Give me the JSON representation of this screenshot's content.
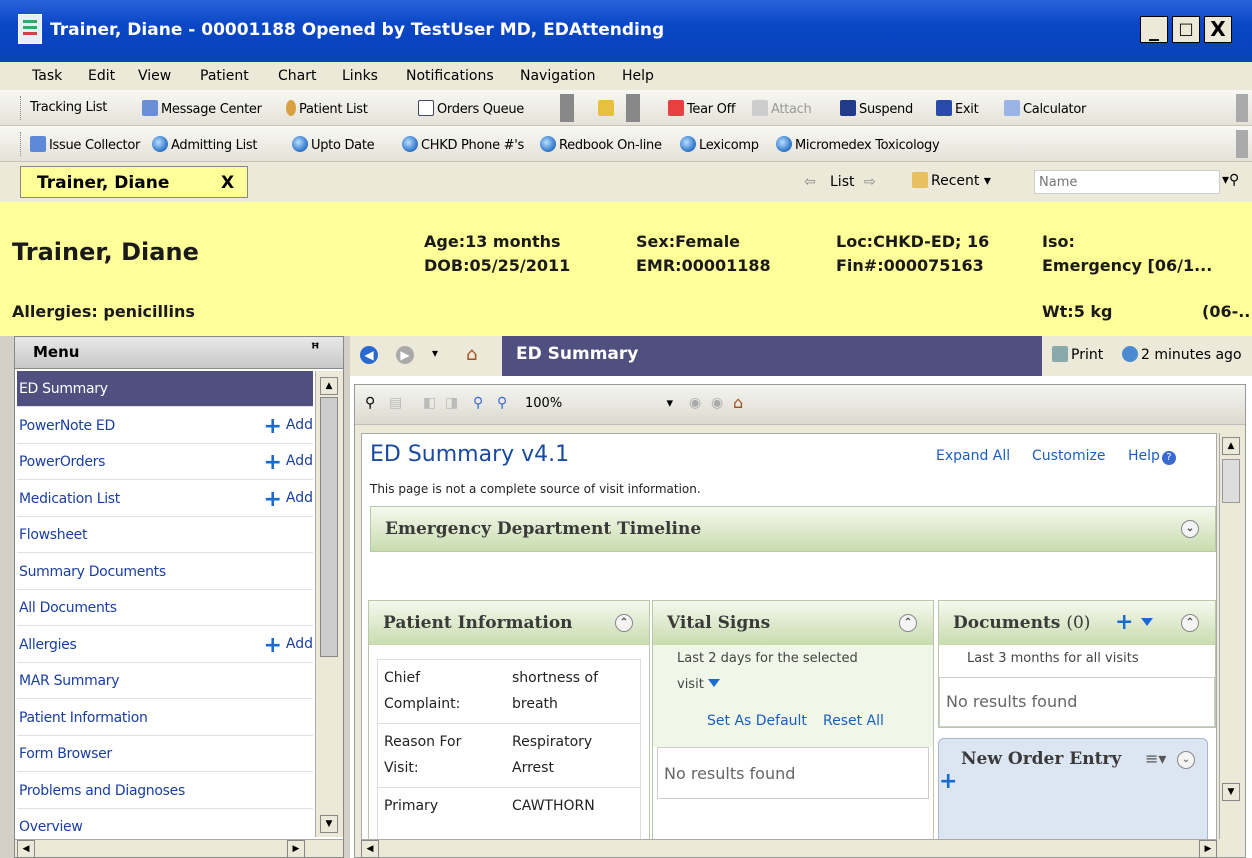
{
  "window": {
    "title": "Trainer, Diane - 00001188 Opened by TestUser MD, EDAttending",
    "minimize": "_",
    "maximize": "□",
    "close": "X"
  },
  "menubar": [
    "Task",
    "Edit",
    "View",
    "Patient",
    "Chart",
    "Links",
    "Notifications",
    "Navigation",
    "Help"
  ],
  "toolbar1": {
    "items": [
      "Tracking List",
      "Message Center",
      "Patient List",
      "Orders Queue",
      "Tear Off",
      "Attach",
      "Suspend",
      "Exit",
      "Calculator"
    ]
  },
  "toolbar2": {
    "items": [
      "Issue Collector",
      "Admitting List",
      "Upto Date",
      "CHKD Phone #'s",
      "Redbook On-line",
      "Lexicomp",
      "Micromedex Toxicology"
    ]
  },
  "tabrow": {
    "patient_tab": "Trainer, Diane",
    "tab_close": "X",
    "list_label": "List",
    "recent_label": "Recent",
    "name_placeholder": "Name"
  },
  "banner": {
    "name": "Trainer, Diane",
    "allergies": "Allergies: penicillins",
    "age": "Age:13 months",
    "dob": "DOB:05/25/2011",
    "sex": "Sex:Female",
    "emr": "EMR:00001188",
    "loc": "Loc:CHKD-ED; 16",
    "fin": "Fin#:000075163",
    "iso": "Iso:",
    "encounter": "Emergency [06/1...",
    "wt": "Wt:5 kg",
    "wt_date": "(06-..."
  },
  "leftmenu": {
    "header": "Menu",
    "pin": "ᵖ",
    "add_label": "Add",
    "items": [
      {
        "label": "ED Summary",
        "add": false,
        "selected": true
      },
      {
        "label": "PowerNote ED",
        "add": true
      },
      {
        "label": "PowerOrders",
        "add": true
      },
      {
        "label": "Medication List",
        "add": true
      },
      {
        "label": "Flowsheet",
        "add": false
      },
      {
        "label": "Summary Documents",
        "add": false
      },
      {
        "label": "All Documents",
        "add": false
      },
      {
        "label": "Allergies",
        "add": true
      },
      {
        "label": "MAR Summary",
        "add": false
      },
      {
        "label": "Patient Information",
        "add": false
      },
      {
        "label": "Form Browser",
        "add": false
      },
      {
        "label": "Problems and Diagnoses",
        "add": false
      },
      {
        "label": "Overview",
        "add": false
      }
    ]
  },
  "rightpane": {
    "page_title": "ED Summary",
    "print": "Print",
    "refresh_time": "2 minutes ago",
    "zoom": "100%"
  },
  "content": {
    "title": "ED Summary v4.1",
    "expand_all": "Expand All",
    "customize": "Customize",
    "help": "Help",
    "notice": "This page is not a complete source of visit information.",
    "timeline": "Emergency Department Timeline",
    "patient_info": {
      "title": "Patient Information",
      "rows": [
        {
          "k1": "Chief",
          "k2": "Complaint:",
          "v1": "shortness of",
          "v2": "breath"
        },
        {
          "k1": "Reason For",
          "k2": "Visit:",
          "v1": "Respiratory",
          "v2": "Arrest"
        },
        {
          "k1": "Primary",
          "k2": "",
          "v1": "CAWTHORN",
          "v2": ""
        }
      ]
    },
    "vitals": {
      "title": "Vital Signs",
      "sub1": "Last 2 days for the selected",
      "sub2": "visit",
      "set_default": "Set As Default",
      "reset": "Reset All",
      "empty": "No results found"
    },
    "documents": {
      "title": "Documents",
      "count": "(0)",
      "sub": "Last 3 months for all visits",
      "empty": "No results found"
    },
    "new_order": {
      "title": "New Order Entry"
    }
  }
}
